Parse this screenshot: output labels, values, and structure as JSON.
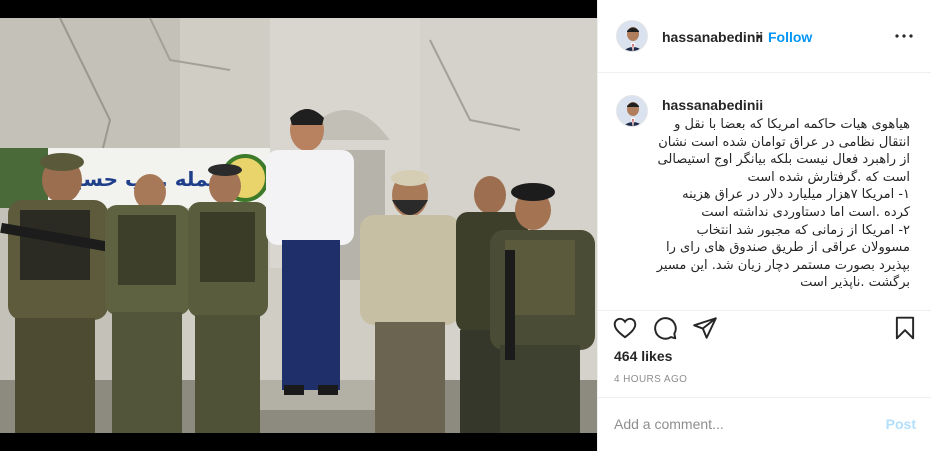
{
  "post": {
    "username": "hassanabedinii",
    "separator": "•",
    "follow_label": "Follow",
    "more_icon": "more-horizontal-icon"
  },
  "photo": {
    "description_icon": "post-photo",
    "banner_text": "حمله ...ب حسين"
  },
  "caption": {
    "username": "hassanabedinii",
    "text": "هیاهوی هیات حاکمه امریکا که بعضا با نقل و انتقال نظامی در عراق توامان شده است نشان از راهبرد فعال نیست بلکه بیانگر اوج استیصالی است که .گرفتارش شده است\n۱- امریکا ۷هزار میلیارد دلار در عراق هزینه کرده .است اما دستاوردی نداشته است\n۲- امریکا از زمانی که مجبور شد انتخاب مسوولان عراقی از طریق صندوق های رای را بپذیرد بصورت مستمر دچار زیان شد. این مسیر برگشت .ناپذیر است"
  },
  "actions": {
    "like_icon": "heart-icon",
    "comment_icon": "comment-icon",
    "share_icon": "share-icon",
    "save_icon": "bookmark-icon"
  },
  "likes": "464 likes",
  "timestamp": "4 HOURS AGO",
  "comment": {
    "placeholder": "Add a comment...",
    "post_label": "Post"
  },
  "colors": {
    "accent": "#0095f6",
    "post_disabled": "#b2dffc",
    "text": "#262626",
    "muted": "#8e8e8e"
  }
}
